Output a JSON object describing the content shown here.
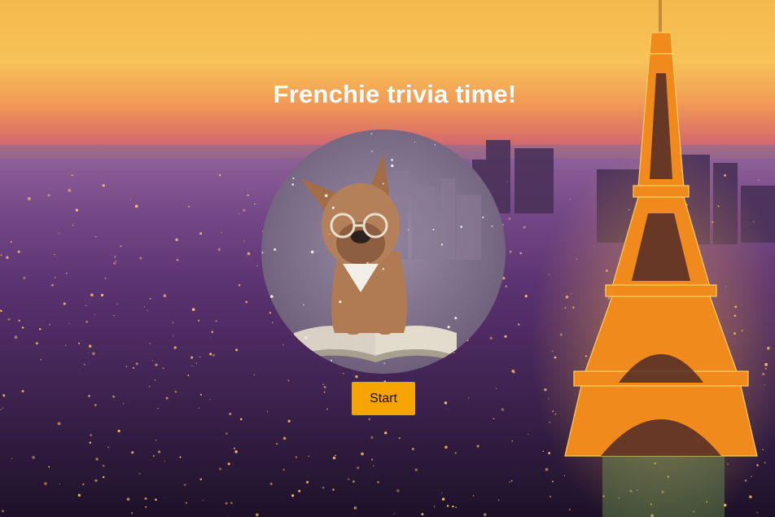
{
  "page": {
    "title": "Frenchie trivia time!"
  },
  "portrait": {
    "subject": "french-bulldog-with-glasses-reading-book"
  },
  "background": {
    "scene": "paris-skyline-eiffel-tower-dusk"
  },
  "actions": {
    "start_label": "Start"
  },
  "colors": {
    "button": "#f6a400",
    "title_text": "#ffffff",
    "sky_top": "#f7c45a",
    "sky_bottom": "#7a3d7e"
  }
}
